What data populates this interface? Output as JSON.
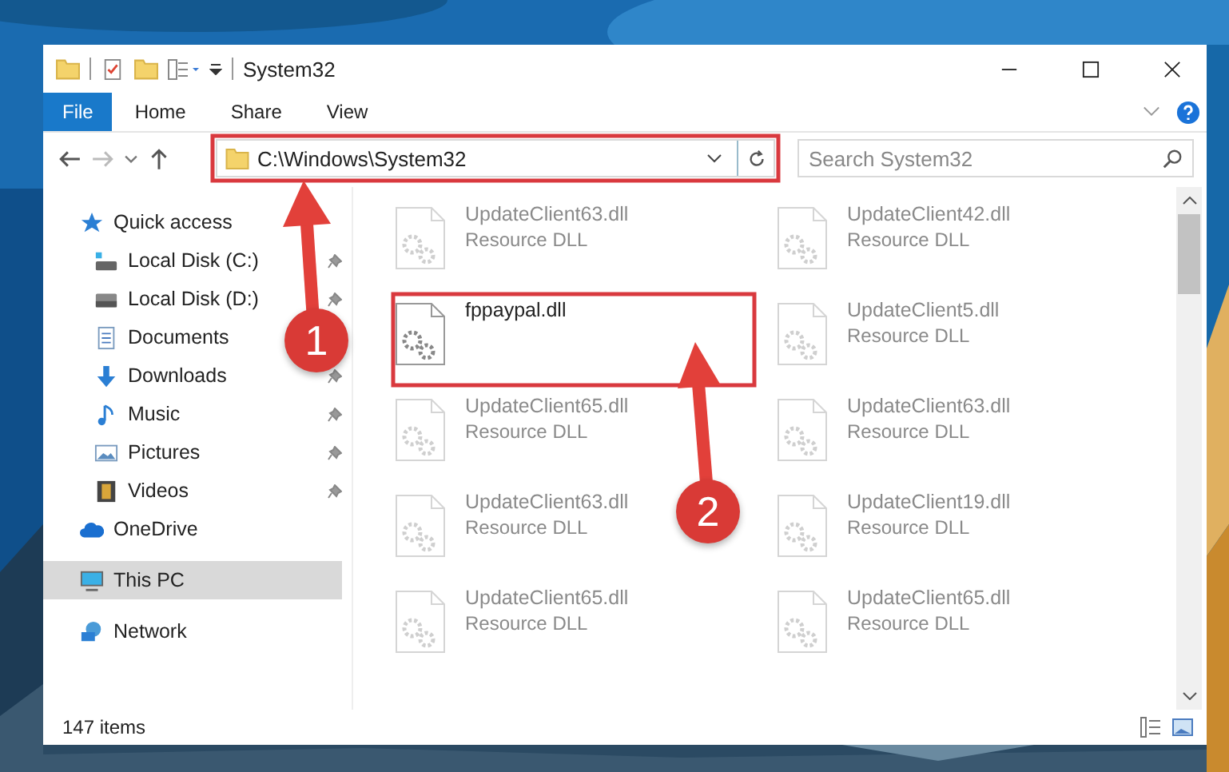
{
  "window": {
    "title": "System32"
  },
  "ribbon": {
    "tabs": [
      {
        "label": "File",
        "selected": true
      },
      {
        "label": "Home",
        "selected": false
      },
      {
        "label": "Share",
        "selected": false
      },
      {
        "label": "View",
        "selected": false
      }
    ]
  },
  "address_bar": {
    "path": "C:\\Windows\\System32"
  },
  "search": {
    "placeholder": "Search System32"
  },
  "sidebar": {
    "items": [
      {
        "label": "Quick access",
        "selected": false,
        "children": [
          {
            "label": "Local Disk (C:)",
            "pinned": true,
            "selected": false
          },
          {
            "label": "Local Disk (D:)",
            "pinned": true,
            "selected": false
          },
          {
            "label": "Documents",
            "selected": false
          },
          {
            "label": "Downloads",
            "pinned": true,
            "selected": false
          },
          {
            "label": "Music",
            "pinned": true,
            "selected": false
          },
          {
            "label": "Pictures",
            "pinned": true,
            "selected": false
          },
          {
            "label": "Videos",
            "pinned": true,
            "selected": false
          }
        ]
      },
      {
        "label": "OneDrive",
        "selected": false
      },
      {
        "label": "This PC",
        "selected": true
      },
      {
        "label": "Network",
        "selected": false
      }
    ]
  },
  "files": [
    {
      "name": "UpdateClient63.dll",
      "type": "Resource DLL",
      "dimmed": true
    },
    {
      "name": "UpdateClient42.dll",
      "type": "Resource DLL",
      "dimmed": true
    },
    {
      "name": "fppaypal.dll",
      "dimmed": false
    },
    {
      "name": "UpdateClient5.dll",
      "type": "Resource DLL",
      "dimmed": true
    },
    {
      "name": "UpdateClient65.dll",
      "type": "Resource DLL",
      "dimmed": true
    },
    {
      "name": "UpdateClient63.dll",
      "type": "Resource DLL",
      "dimmed": true
    },
    {
      "name": "UpdateClient63.dll",
      "type": "Resource DLL",
      "dimmed": true
    },
    {
      "name": "UpdateClient19.dll",
      "type": "Resource DLL",
      "dimmed": true
    },
    {
      "name": "UpdateClient65.dll",
      "type": "Resource DLL",
      "dimmed": true
    },
    {
      "name": "UpdateClient65.dll",
      "type": "Resource DLL",
      "dimmed": true
    }
  ],
  "status_bar": {
    "item_count": "147 items"
  },
  "annotations": [
    {
      "number": "1"
    },
    {
      "number": "2"
    }
  ]
}
